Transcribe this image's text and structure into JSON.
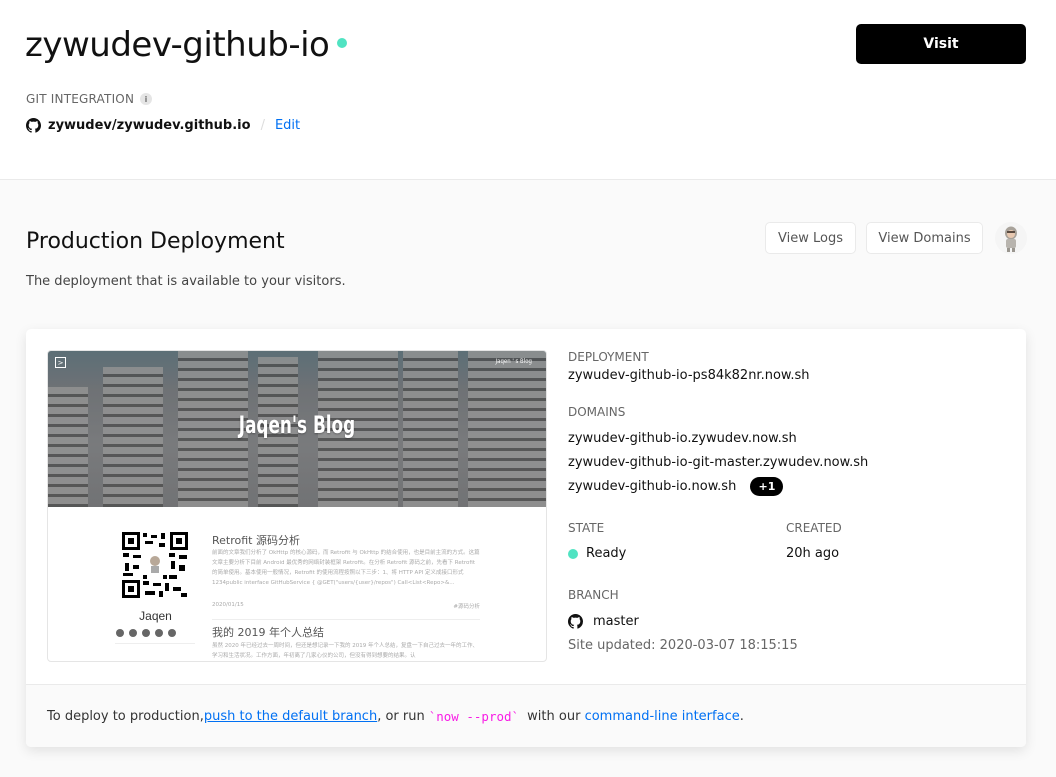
{
  "header": {
    "project_name": "zywudev-github-io",
    "status_color": "#50e3c2",
    "visit_label": "Visit",
    "git_integration_label": "GIT INTEGRATION",
    "info_icon": "i",
    "repo": "zywudev/zywudev.github.io",
    "separator": "/",
    "edit_label": "Edit"
  },
  "production": {
    "title": "Production Deployment",
    "description": "The deployment that is available to your visitors.",
    "view_logs_label": "View Logs",
    "view_domains_label": "View Domains"
  },
  "preview": {
    "toggle_icon": ">",
    "header_small": "Jaqen ' s Blog",
    "hero_title": "Jaqen's Blog",
    "author": "Jaqen",
    "posts": [
      {
        "title": "Retrofit 源码分析",
        "excerpt": "前面的文章我们分析了 OkHttp 的核心源码，而 Retrofit 与 OkHttp 的结合使用，也是目前主流的方式。这篇文章主要分析下目前 Android 最优秀的网络封装框架 Retrofit。在分析 Retrofit 源码之前，先看下 Retrofit 的简单使用。基本使用一般情况，Retrofit 的使用流程按照以下三步：1、将 HTTP API 定义成接口形式 1234public interface GitHubService { @GET(\"users/{user}/repos\") Call<List<Repo>&...",
        "date": "2020/01/15",
        "tag": "#源码分析"
      },
      {
        "title": "我的 2019 年个人总结",
        "excerpt": "虽然 2020 年已经过去一周时间，但还是想记录一下我的 2019 年个人总结，复盘一下自己过去一年的工作、学习和生活状况。工作方面，年初离了几家心仪的公司，但没有得到想要的结果。认"
      }
    ]
  },
  "deployment": {
    "deployment_label": "DEPLOYMENT",
    "deployment_url": "zywudev-github-io-ps84k82nr.now.sh",
    "domains_label": "DOMAINS",
    "domains": [
      "zywudev-github-io.zywudev.now.sh",
      "zywudev-github-io-git-master.zywudev.now.sh",
      "zywudev-github-io.now.sh"
    ],
    "extra_domains_badge": "+1",
    "state_label": "STATE",
    "state_value": "Ready",
    "state_color": "#50e3c2",
    "created_label": "CREATED",
    "created_value": "20h ago",
    "branch_label": "BRANCH",
    "branch_value": "master",
    "site_updated": "Site updated: 2020-03-07 18:15:15"
  },
  "footer": {
    "text_before": "To deploy to production, ",
    "link_push": "push to the default branch",
    "text_middle": ", or run ",
    "code": "`now --prod`",
    "text_after": " with our ",
    "link_cli": "command-line interface",
    "text_end": "."
  }
}
